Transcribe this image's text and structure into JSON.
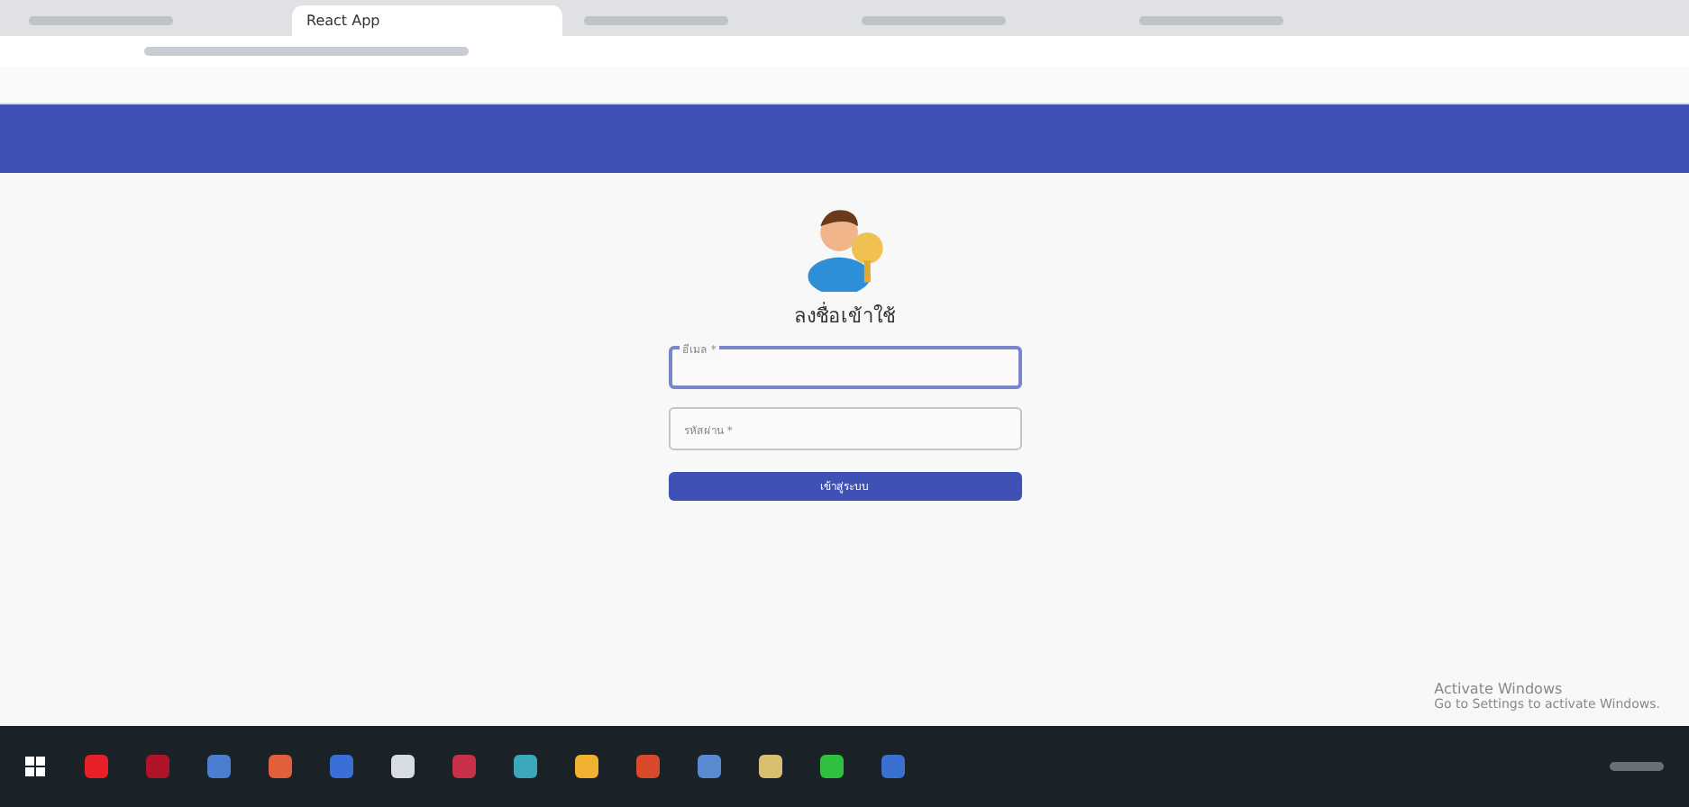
{
  "browser": {
    "tabs": [
      {
        "kind": "blurred",
        "selected": false
      },
      {
        "kind": "titled",
        "title": "React App",
        "selected": true
      },
      {
        "kind": "blurred",
        "selected": false
      },
      {
        "kind": "blurred",
        "selected": false
      },
      {
        "kind": "blurred",
        "selected": false
      }
    ]
  },
  "login": {
    "title": "ลงชื่อเข้าใช้",
    "fields": [
      {
        "label": "อีเมล *",
        "focused": true
      },
      {
        "label": "รหัสผ่าน *",
        "focused": false
      }
    ],
    "button": "เข้าสู่ระบบ"
  },
  "activation": {
    "title": "Activate Windows",
    "subtitle": "Go to Settings to activate Windows."
  },
  "taskbar": {
    "apps": [
      {
        "color": "#e8202a"
      },
      {
        "color": "#b0142a"
      },
      {
        "color": "#4a7fd0"
      },
      {
        "color": "#e0603a"
      },
      {
        "color": "#3b6fd8"
      },
      {
        "color": "#d8dde4"
      },
      {
        "color": "#c8304a"
      },
      {
        "color": "#3aa8b8"
      },
      {
        "color": "#f0b030"
      },
      {
        "color": "#d84a2a"
      },
      {
        "color": "#5a8ad0"
      },
      {
        "color": "#d8c070"
      },
      {
        "color": "#30c040"
      },
      {
        "color": "#3a70d0"
      }
    ]
  }
}
